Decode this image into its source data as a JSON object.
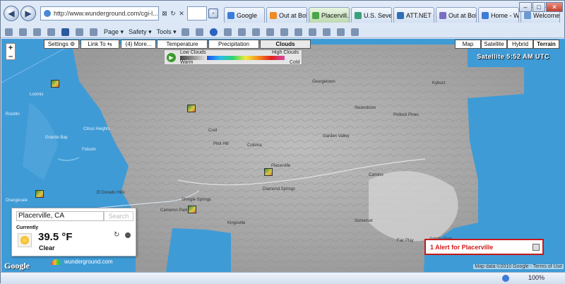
{
  "browser": {
    "url": "http://www.wunderground.com/cgi-l...",
    "tabs": [
      {
        "label": "Google",
        "color": "#3b7ddd"
      },
      {
        "label": "Out at Bob's",
        "color": "#f08a24"
      },
      {
        "label": "Placervill...",
        "color": "#4aa54a"
      },
      {
        "label": "U.S. Severe ...",
        "color": "#3aa17a"
      },
      {
        "label": "ATT.NET - ...",
        "color": "#2f6fb6"
      },
      {
        "label": "Out at Bob'...",
        "color": "#7b6cc4"
      },
      {
        "label": "Home - Wi...",
        "color": "#3d7bd8"
      },
      {
        "label": "Welcome t...",
        "color": "#6a9ad3"
      }
    ],
    "active_tab_index": 2,
    "commands": [
      {
        "label": "Page",
        "icon": "page-icon"
      },
      {
        "label": "Safety",
        "icon": "safety-icon"
      },
      {
        "label": "Tools",
        "icon": "tools-icon"
      }
    ],
    "zoom": "100%"
  },
  "map": {
    "toolbar": {
      "settings": "Settings",
      "link_to": "Link To",
      "more": "(4) More..."
    },
    "layer_tabs": [
      "Temperature",
      "Precipitation",
      "Clouds"
    ],
    "active_layer": "Clouds",
    "legend": {
      "low_clouds": "Low Clouds",
      "high_clouds": "High Clouds",
      "warm": "Warm",
      "cold": "Cold"
    },
    "map_types": [
      "Map",
      "Satellite",
      "Hybrid",
      "Terrain"
    ],
    "active_map_type": "Terrain",
    "satellite_label": "Satellite  5:52 AM UTC",
    "copyright": "Map data ©2010 Google - Terms of Use",
    "google_logo": "Google",
    "wu_logo": "wunderground.com",
    "cities": [
      {
        "name": "Loomis"
      },
      {
        "name": "Rocklin"
      },
      {
        "name": "Granite Bay"
      },
      {
        "name": "Citrus Heights"
      },
      {
        "name": "Folsom"
      },
      {
        "name": "Orangevale"
      },
      {
        "name": "El Dorado Hills"
      },
      {
        "name": "Shingle Springs"
      },
      {
        "name": "Cameron Park"
      },
      {
        "name": "Diamond Springs"
      },
      {
        "name": "Placerville"
      },
      {
        "name": "Pollock Pines"
      },
      {
        "name": "Cool"
      },
      {
        "name": "Pilot Hill"
      },
      {
        "name": "Georgetown"
      },
      {
        "name": "Coloma"
      },
      {
        "name": "Garden Valley"
      },
      {
        "name": "Kingsville"
      },
      {
        "name": "Somerset"
      },
      {
        "name": "Fair Play"
      },
      {
        "name": "Grizzly Flats"
      },
      {
        "name": "Camino"
      },
      {
        "name": "Kyburz"
      },
      {
        "name": "Swansboro"
      }
    ]
  },
  "weather": {
    "location": "Placerville, CA",
    "search_label": "Search",
    "currently": "Currently",
    "temperature": "39.5 °F",
    "condition": "Clear"
  },
  "alert": {
    "text": "1 Alert for Placerville"
  }
}
